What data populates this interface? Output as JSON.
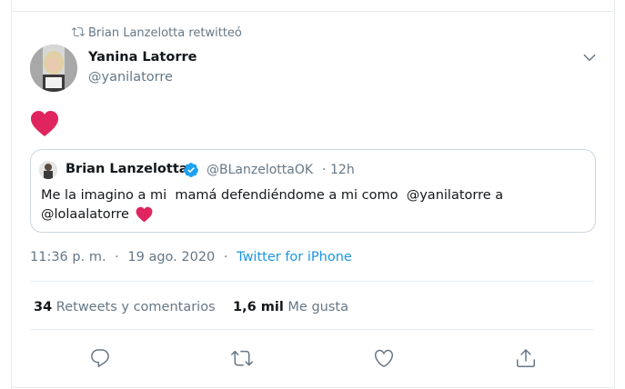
{
  "retweet": {
    "text": "Brian Lanzelotta retwitteó",
    "icon": "retweet-icon"
  },
  "author": {
    "name": "Yanina Latorre",
    "handle": "@yanilatorre"
  },
  "tweet": {
    "content_icon": "red-heart-emoji"
  },
  "quoted": {
    "name": "Brian Lanzelotta",
    "verified": true,
    "handle": "@BLanzelottaOK",
    "dot": "·",
    "time": "12h",
    "line1": "Me la imagino a mi  mamá defendiéndome a mi como  @yanilatorre a",
    "line2": "@lolaalatorre"
  },
  "meta": {
    "time": "11:36 p. m.",
    "sep": "·",
    "date": "19 ago. 2020",
    "client": "Twitter for iPhone"
  },
  "stats": {
    "retweets_count": "34",
    "retweets_label": "Retweets y comentarios",
    "likes_count": "1,6 mil",
    "likes_label": "Me gusta"
  },
  "colors": {
    "accent": "#1b95e0",
    "secondary_text": "#657786",
    "heart": "#e0245e",
    "verified": "#1da1f2",
    "border": "#e6ecf0"
  },
  "actions": [
    "reply-icon",
    "retweet-icon",
    "like-icon",
    "share-icon"
  ]
}
